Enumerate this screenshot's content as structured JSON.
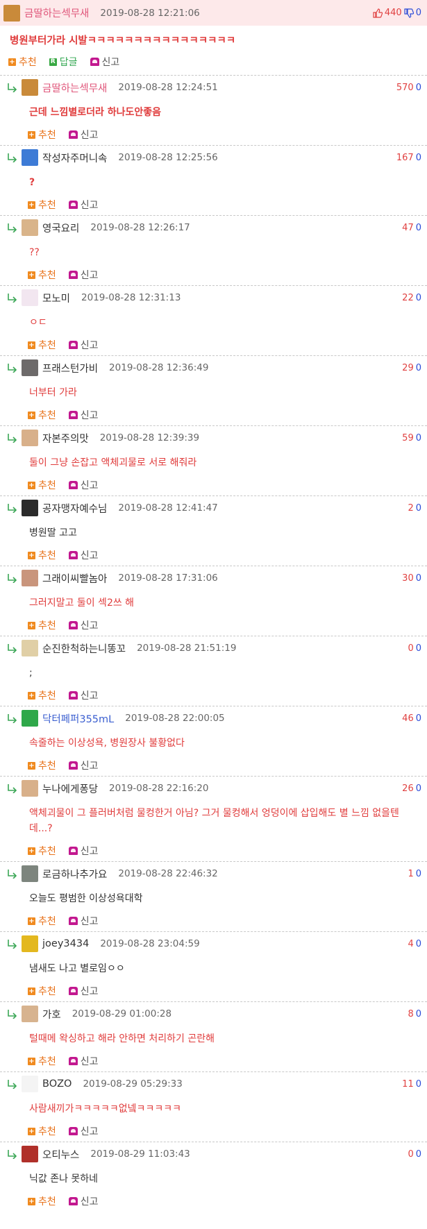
{
  "post": {
    "author": "금딸하는섹무새",
    "date": "2019-08-28 12:21:06",
    "up": "440",
    "down": "0",
    "body": "병원부터가라 시발ㅋㅋㅋㅋㅋㅋㅋㅋㅋㅋㅋㅋㅋㅋㅋㅋ",
    "actions": {
      "recommend": "추천",
      "reply": "답글",
      "report": "신고"
    },
    "avatar_color": "#c98a3a"
  },
  "comments": [
    {
      "author": "금딸하는섹무새",
      "nick_color": "pink",
      "date": "2019-08-28 12:24:51",
      "up": "570",
      "down": "0",
      "body": "근데 느낌별로더라 하나도안좋음",
      "body_color": "red",
      "body_bold": true,
      "avatar_color": "#c98a3a"
    },
    {
      "author": "작성자주머니속",
      "nick_color": "dark",
      "date": "2019-08-28 12:25:56",
      "up": "167",
      "down": "0",
      "body": "?",
      "body_color": "red",
      "body_bold": true,
      "avatar_color": "#3d7bd6"
    },
    {
      "author": "영국요리",
      "nick_color": "dark",
      "date": "2019-08-28 12:26:17",
      "up": "47",
      "down": "0",
      "body": "??",
      "body_color": "red",
      "body_bold": false,
      "avatar_color": "#d9b48a"
    },
    {
      "author": "모노미",
      "nick_color": "dark",
      "date": "2019-08-28 12:31:13",
      "up": "22",
      "down": "0",
      "body": "ㅇㄷ",
      "body_color": "red",
      "body_bold": false,
      "avatar_color": "#f2e6f0"
    },
    {
      "author": "프래스턴가비",
      "nick_color": "dark",
      "date": "2019-08-28 12:36:49",
      "up": "29",
      "down": "0",
      "body": "너부터 가라",
      "body_color": "red",
      "body_bold": false,
      "avatar_color": "#6d6a6a"
    },
    {
      "author": "자본주의맛",
      "nick_color": "dark",
      "date": "2019-08-28 12:39:39",
      "up": "59",
      "down": "0",
      "body": "둘이 그냥 손잡고 액체괴물로 서로 해줘라",
      "body_color": "red",
      "body_bold": false,
      "avatar_color": "#d8b08a"
    },
    {
      "author": "공자맹자예수님",
      "nick_color": "dark",
      "date": "2019-08-28 12:41:47",
      "up": "2",
      "down": "0",
      "body": "병원딸 고고",
      "body_color": "black",
      "body_bold": false,
      "avatar_color": "#2b2b2b"
    },
    {
      "author": "그래이씨빨놈아",
      "nick_color": "dark",
      "date": "2019-08-28 17:31:06",
      "up": "30",
      "down": "0",
      "body": "그러지말고 둘이 섹2쓰 해",
      "body_color": "red",
      "body_bold": false,
      "avatar_color": "#c9957c"
    },
    {
      "author": "순진한척하는니똥꼬",
      "nick_color": "dark",
      "date": "2019-08-28 21:51:19",
      "up": "0",
      "down": "0",
      "body": ";",
      "body_color": "black",
      "body_bold": false,
      "avatar_color": "#e0cfa6"
    },
    {
      "author": "닥터페퍼355mL",
      "nick_color": "blue",
      "date": "2019-08-28 22:00:05",
      "up": "46",
      "down": "0",
      "body": "속줄하는 이상성욕, 병원장사 불황없다",
      "body_color": "red",
      "body_bold": false,
      "avatar_color": "#2fa84a"
    },
    {
      "author": "누나에게퐁당",
      "nick_color": "dark",
      "date": "2019-08-28 22:16:20",
      "up": "26",
      "down": "0",
      "body": "액체괴물이 그 플러버처럼 물컹한거 아님? 그거 물컹해서 엉덩이에 삽입해도 별 느낌 없을텐데...?",
      "body_color": "red",
      "body_bold": false,
      "avatar_color": "#d8b08a"
    },
    {
      "author": "로금하나추가요",
      "nick_color": "dark",
      "date": "2019-08-28 22:46:32",
      "up": "1",
      "down": "0",
      "body": "오늘도 평범한 이상성욕대학",
      "body_color": "black",
      "body_bold": false,
      "avatar_color": "#7d857e"
    },
    {
      "author": "joey3434",
      "nick_color": "dark",
      "date": "2019-08-28 23:04:59",
      "up": "4",
      "down": "0",
      "body": "냄새도 나고 별로임ㅇㅇ",
      "body_color": "black",
      "body_bold": false,
      "avatar_color": "#e3b81f"
    },
    {
      "author": "가호",
      "nick_color": "dark",
      "date": "2019-08-29 01:00:28",
      "up": "8",
      "down": "0",
      "body": "털때메 왁싱하고 해라 안하면 처리하기 곤란해",
      "body_color": "red",
      "body_bold": false,
      "avatar_color": "#d7b38f"
    },
    {
      "author": "BOZO",
      "nick_color": "dark",
      "date": "2019-08-29 05:29:33",
      "up": "11",
      "down": "0",
      "body": "사람새끼가ㅋㅋㅋㅋㅋ없넼ㅋㅋㅋㅋㅋ",
      "body_color": "red",
      "body_bold": false,
      "avatar_color": "#f4f4f4"
    },
    {
      "author": "오티누스",
      "nick_color": "dark",
      "date": "2019-08-29 11:03:43",
      "up": "0",
      "down": "0",
      "body": "닉값 존나 못하네",
      "body_color": "black",
      "body_bold": false,
      "avatar_color": "#b0302a"
    }
  ],
  "comment_actions": {
    "recommend": "추천",
    "report": "신고"
  },
  "colors": {
    "up": "#e04040",
    "down": "#2a4bd8",
    "top_bg": "#fde9ea"
  },
  "icons": {
    "up": "thumbs-up-icon",
    "down": "thumbs-down-icon",
    "reply": "reply-arrow-icon",
    "recommend": "plus-icon",
    "report": "siren-icon"
  }
}
